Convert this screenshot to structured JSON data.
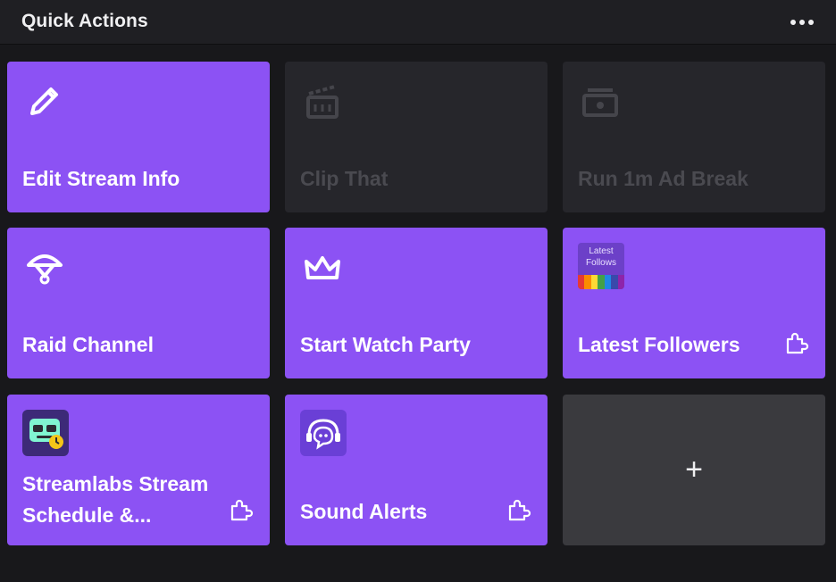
{
  "header": {
    "title": "Quick Actions",
    "more_icon": "more-horizontal-icon"
  },
  "tiles": [
    {
      "label": "Edit Stream Info",
      "icon": "pencil-icon",
      "state": "enabled"
    },
    {
      "label": "Clip That",
      "icon": "clapperboard-icon",
      "state": "disabled"
    },
    {
      "label": "Run 1m Ad Break",
      "icon": "money-icon",
      "state": "disabled"
    },
    {
      "label": "Raid Channel",
      "icon": "parachute-icon",
      "state": "enabled"
    },
    {
      "label": "Start Watch Party",
      "icon": "crown-icon",
      "state": "enabled"
    },
    {
      "label": "Latest Followers",
      "icon": "latest-followers-thumbnail",
      "thumb_text": "Latest Follows",
      "state": "enabled",
      "extension": true
    },
    {
      "label": "Streamlabs Stream Schedule &...",
      "icon": "streamlabs-thumbnail",
      "state": "enabled",
      "extension": true
    },
    {
      "label": "Sound Alerts",
      "icon": "sound-alerts-thumbnail",
      "state": "enabled",
      "extension": true
    },
    {
      "label": "+",
      "icon": "plus-icon",
      "state": "add"
    }
  ],
  "colors": {
    "accent_purple": "#8c52f4",
    "background": "#18181b",
    "disabled_tile": "#26262b",
    "add_tile": "#3a3a3e"
  }
}
